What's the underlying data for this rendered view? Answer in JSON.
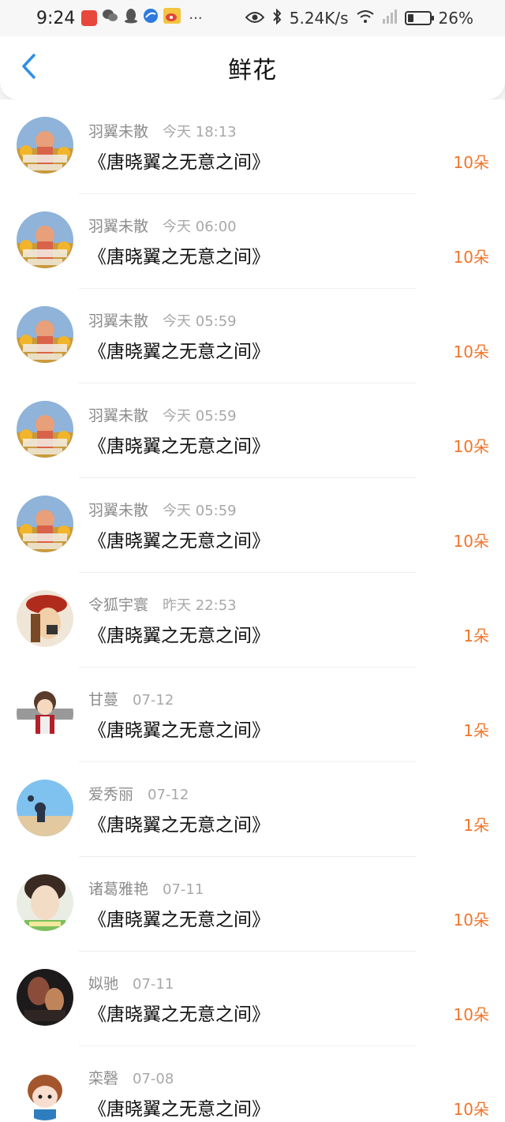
{
  "status_bar": {
    "time": "9:24",
    "network_speed": "5.24K/s",
    "battery_percent": "26%",
    "battery_level": 0.26,
    "notification_icons": [
      "shopping-app-icon",
      "wechat-icon",
      "qq-icon",
      "browser-icon",
      "weibo-icon"
    ],
    "more": "···"
  },
  "header": {
    "title": "鲜花",
    "back_icon": "chevron-left-icon",
    "accent_color": "#2f8fe6"
  },
  "flowers": {
    "count_color": "#f0752b",
    "items": [
      {
        "user": "羽翼未散",
        "time": "今天 18:13",
        "book": "《唐晓翼之无意之间》",
        "count": "10朵",
        "avatar": "sunflower-avatar"
      },
      {
        "user": "羽翼未散",
        "time": "今天 06:00",
        "book": "《唐晓翼之无意之间》",
        "count": "10朵",
        "avatar": "sunflower-avatar"
      },
      {
        "user": "羽翼未散",
        "time": "今天 05:59",
        "book": "《唐晓翼之无意之间》",
        "count": "10朵",
        "avatar": "sunflower-avatar"
      },
      {
        "user": "羽翼未散",
        "time": "今天 05:59",
        "book": "《唐晓翼之无意之间》",
        "count": "10朵",
        "avatar": "sunflower-avatar"
      },
      {
        "user": "羽翼未散",
        "time": "今天 05:59",
        "book": "《唐晓翼之无意之间》",
        "count": "10朵",
        "avatar": "sunflower-avatar"
      },
      {
        "user": "令狐宇寰",
        "time": "昨天 22:53",
        "book": "《唐晓翼之无意之间》",
        "count": "1朵",
        "avatar": "red-hat-girl-avatar"
      },
      {
        "user": "甘蔓",
        "time": "07-12",
        "book": "《唐晓翼之无意之间》",
        "count": "1朵",
        "avatar": "anime-boy-avatar"
      },
      {
        "user": "爱秀丽",
        "time": "07-12",
        "book": "《唐晓翼之无意之间》",
        "count": "1朵",
        "avatar": "blue-sky-avatar"
      },
      {
        "user": "诸葛雅艳",
        "time": "07-11",
        "book": "《唐晓翼之无意之间》",
        "count": "10朵",
        "avatar": "girl-photo-avatar"
      },
      {
        "user": "姒驰",
        "time": "07-11",
        "book": "《唐晓翼之无意之间》",
        "count": "10朵",
        "avatar": "dark-art-avatar"
      },
      {
        "user": "栾磬",
        "time": "07-08",
        "book": "《唐晓翼之无意之间》",
        "count": "10朵",
        "avatar": "chibi-avatar"
      }
    ]
  }
}
